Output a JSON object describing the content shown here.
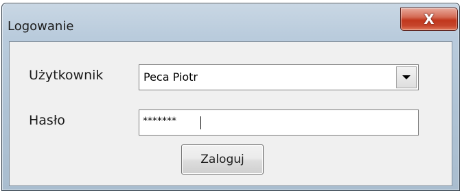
{
  "window": {
    "title": "Logowanie",
    "close_icon": "close-icon",
    "close_glyph": "X"
  },
  "form": {
    "user_label": "Użytkownik",
    "user_value": "Peca Piotr",
    "password_label": "Hasło",
    "password_value": "*******",
    "login_button": "Zaloguj"
  },
  "colors": {
    "close_button": "#c1371d",
    "title_bar": "#b9cbdc",
    "client_area": "#f0f0f0"
  }
}
